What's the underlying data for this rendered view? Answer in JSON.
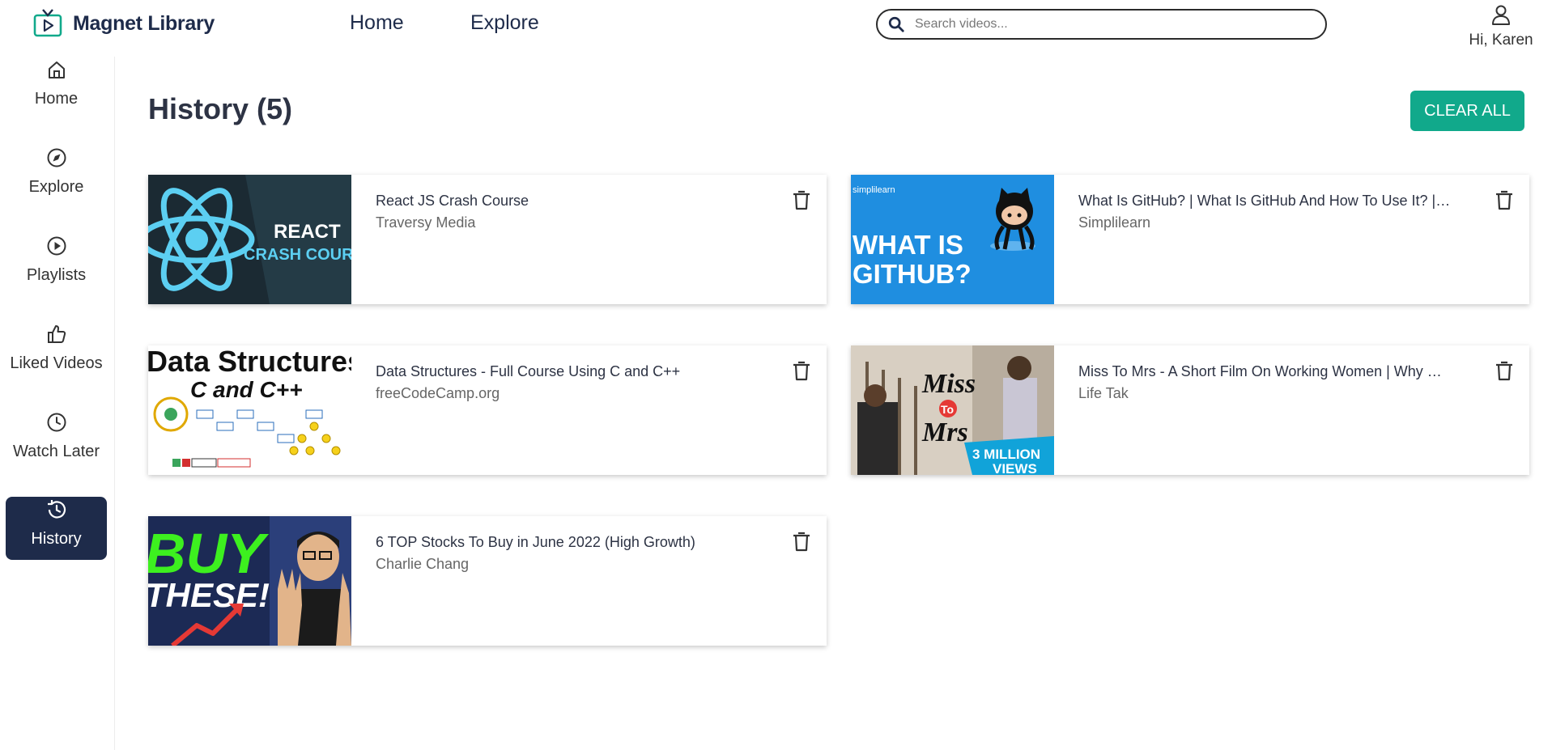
{
  "header": {
    "brand": "Magnet Library",
    "nav": [
      "Home",
      "Explore"
    ],
    "search_placeholder": "Search videos...",
    "greeting": "Hi, Karen"
  },
  "sidebar": {
    "items": [
      {
        "label": "Home",
        "icon": "home-icon"
      },
      {
        "label": "Explore",
        "icon": "compass-icon"
      },
      {
        "label": "Playlists",
        "icon": "play-circle-icon"
      },
      {
        "label": "Liked Videos",
        "icon": "thumbs-up-icon"
      },
      {
        "label": "Watch Later",
        "icon": "clock-icon"
      },
      {
        "label": "History",
        "icon": "history-icon",
        "active": true
      }
    ]
  },
  "main": {
    "title": "History (5)",
    "clear_all_label": "CLEAR ALL",
    "videos": [
      {
        "title": "React JS Crash Course",
        "channel": "Traversy Media",
        "thumb_text": [
          "REACT",
          "CRASH COURSE"
        ]
      },
      {
        "title": "What Is GitHub? | What Is GitHub And How To Use It? | GitHub Tutorial",
        "channel": "Simplilearn",
        "thumb_text": [
          "simplilearn",
          "WHAT IS",
          "GITHUB?"
        ]
      },
      {
        "title": "Data Structures - Full Course Using C and C++",
        "channel": "freeCodeCamp.org",
        "thumb_text": [
          "Data Structures",
          "C and C++"
        ]
      },
      {
        "title": "Miss To Mrs - A Short Film On Working Women | Why Not | Life Tak",
        "channel": "Life Tak",
        "thumb_text": [
          "Miss",
          "To",
          "Mrs",
          "3 MILLION",
          "VIEWS"
        ]
      },
      {
        "title": "6 TOP Stocks To Buy in June 2022 (High Growth)",
        "channel": "Charlie Chang",
        "thumb_text": [
          "BUY",
          "THESE!"
        ]
      }
    ]
  },
  "colors": {
    "accent": "#11a98b",
    "navy": "#1e2b4a"
  }
}
